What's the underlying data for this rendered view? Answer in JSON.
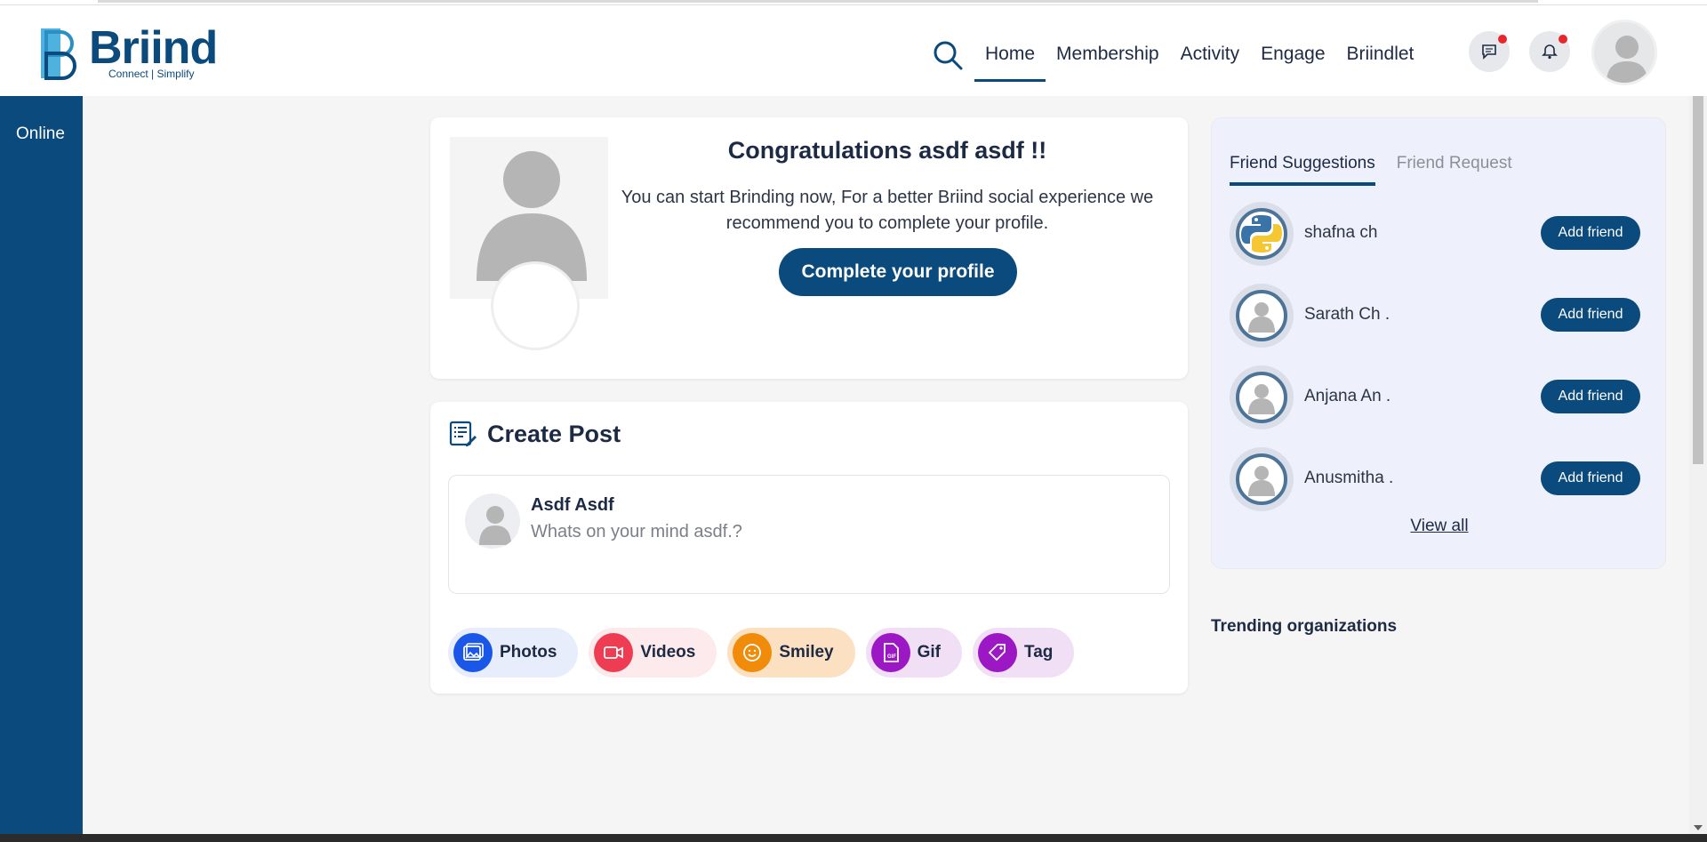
{
  "brand": {
    "name": "Briind",
    "tagline": "Connect | Simplify",
    "color": "#0a4a7c"
  },
  "nav": {
    "items": [
      {
        "label": "Home",
        "active": true
      },
      {
        "label": "Membership"
      },
      {
        "label": "Activity"
      },
      {
        "label": "Engage"
      },
      {
        "label": "Briindlet"
      }
    ],
    "icons": [
      "search-icon",
      "message-icon",
      "bell-icon",
      "avatar"
    ]
  },
  "sidebar": {
    "online_label": "Online"
  },
  "congrats": {
    "title": "Congratulations asdf asdf !!",
    "message": "You can start Brinding now, For a better Briind social experience we recommend you to complete your profile.",
    "button": "Complete your profile"
  },
  "create_post": {
    "title": "Create Post",
    "user_name": "Asdf Asdf",
    "placeholder": "Whats on your mind asdf.?",
    "actions": [
      {
        "label": "Photos",
        "icon": "image-icon",
        "color": "#1a56e8",
        "bg": "#e7edfb"
      },
      {
        "label": "Videos",
        "icon": "video-icon",
        "color": "#ee3d52",
        "bg": "#fdeaec"
      },
      {
        "label": "Smiley",
        "icon": "smiley-icon",
        "color": "#f08c0a",
        "bg": "#fbe1c2"
      },
      {
        "label": "Gif",
        "icon": "gif-icon",
        "color": "#9b18c4",
        "bg": "#f1dff6"
      },
      {
        "label": "Tag",
        "icon": "tag-icon",
        "color": "#9b18c4",
        "bg": "#f1dff6"
      }
    ]
  },
  "friends": {
    "tabs": [
      {
        "label": "Friend Suggestions",
        "active": true
      },
      {
        "label": "Friend Request"
      }
    ],
    "list": [
      {
        "name": "shafna ch",
        "avatar": "python-logo"
      },
      {
        "name": "Sarath Ch ."
      },
      {
        "name": "Anjana An ."
      },
      {
        "name": "Anusmitha ."
      }
    ],
    "add_label": "Add friend",
    "view_all": "View all"
  },
  "trending": {
    "title": "Trending organizations"
  }
}
